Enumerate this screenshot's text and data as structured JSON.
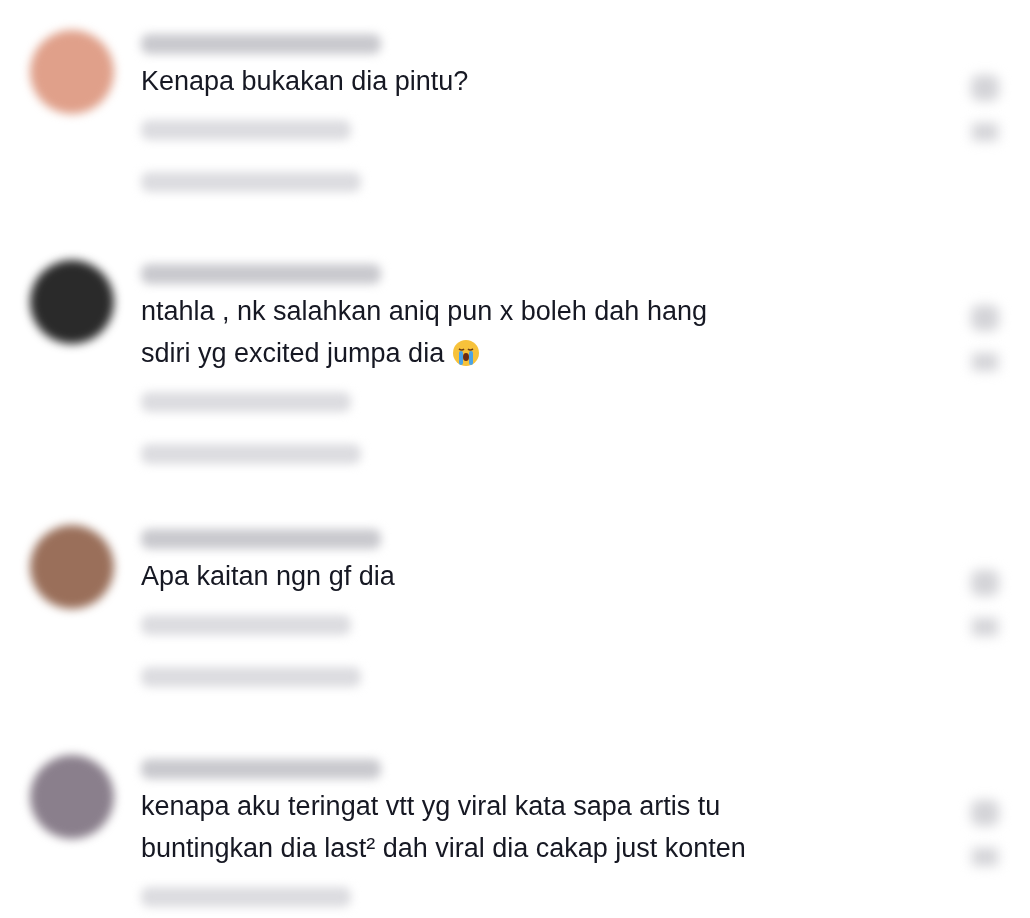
{
  "comments": [
    {
      "lines": [
        "Kenapa bukakan dia pintu?"
      ],
      "trailing_emoji": false
    },
    {
      "lines": [
        "ntahla , nk salahkan aniq pun x boleh dah hang",
        "sdiri yg excited jumpa dia"
      ],
      "trailing_emoji": true
    },
    {
      "lines": [
        "Apa kaitan ngn gf dia"
      ],
      "trailing_emoji": false
    },
    {
      "lines": [
        "kenapa aku teringat vtt yg viral kata sapa artis tu",
        "buntingkan dia last² dah viral dia cakap just konten"
      ],
      "trailing_emoji": false
    }
  ]
}
